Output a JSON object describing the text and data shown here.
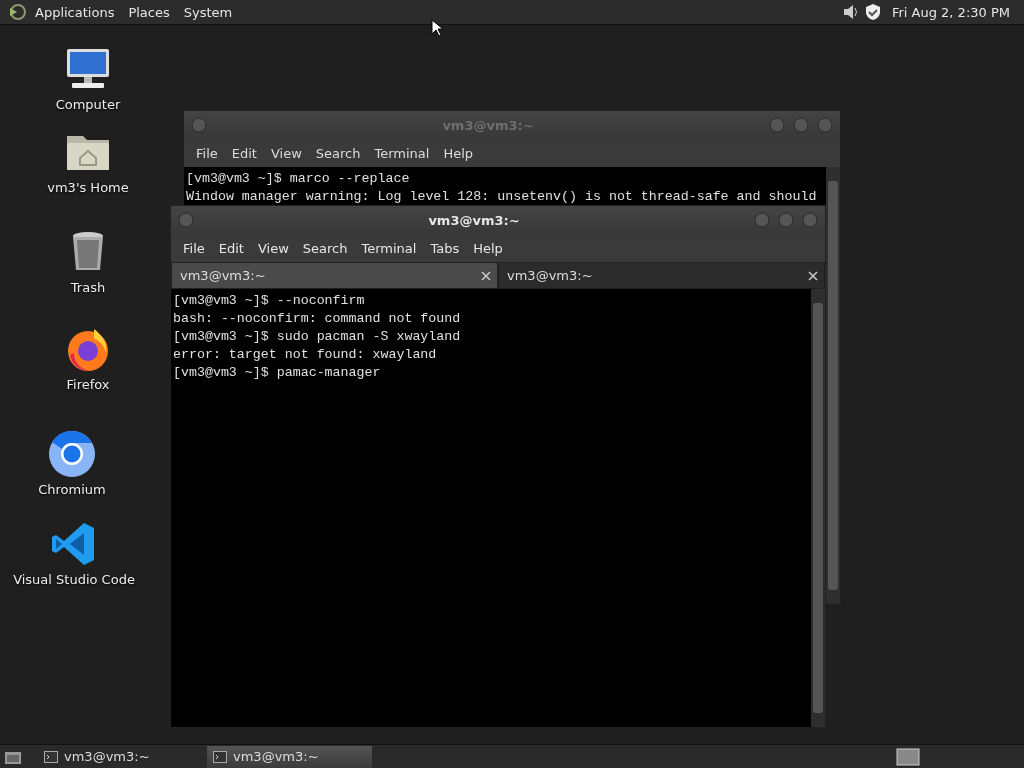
{
  "top_panel": {
    "menus": [
      "Applications",
      "Places",
      "System"
    ],
    "clock": "Fri Aug 2, 2:30 PM"
  },
  "desktop_icons": [
    {
      "label": "Computer",
      "kind": "computer"
    },
    {
      "label": "vm3's Home",
      "kind": "home"
    },
    {
      "label": "Trash",
      "kind": "trash"
    },
    {
      "label": "Firefox",
      "kind": "firefox"
    },
    {
      "label": "Chromium",
      "kind": "chromium"
    },
    {
      "label": "Visual Studio Code",
      "kind": "vscode"
    }
  ],
  "windows": [
    {
      "title": "vm3@vm3:~",
      "active": false,
      "menu": [
        "File",
        "Edit",
        "View",
        "Search",
        "Terminal",
        "Help"
      ],
      "lines": [
        "[vm3@vm3 ~]$ marco --replace",
        "Window manager warning: Log level 128: unsetenv() is not thread-safe and should"
      ]
    },
    {
      "title": "vm3@vm3:~",
      "active": true,
      "menu": [
        "File",
        "Edit",
        "View",
        "Search",
        "Terminal",
        "Tabs",
        "Help"
      ],
      "tabs": [
        {
          "label": "vm3@vm3:~",
          "selected": true
        },
        {
          "label": "vm3@vm3:~",
          "selected": false
        }
      ],
      "lines": [
        "[vm3@vm3 ~]$ --noconfirm",
        "bash: --noconfirm: command not found",
        "[vm3@vm3 ~]$ sudo pacman -S xwayland",
        "error: target not found: xwayland",
        "[vm3@vm3 ~]$ pamac-manager"
      ]
    }
  ],
  "taskbar": {
    "items": [
      {
        "label": "vm3@vm3:~",
        "selected": false
      },
      {
        "label": "vm3@vm3:~",
        "selected": true
      }
    ]
  }
}
